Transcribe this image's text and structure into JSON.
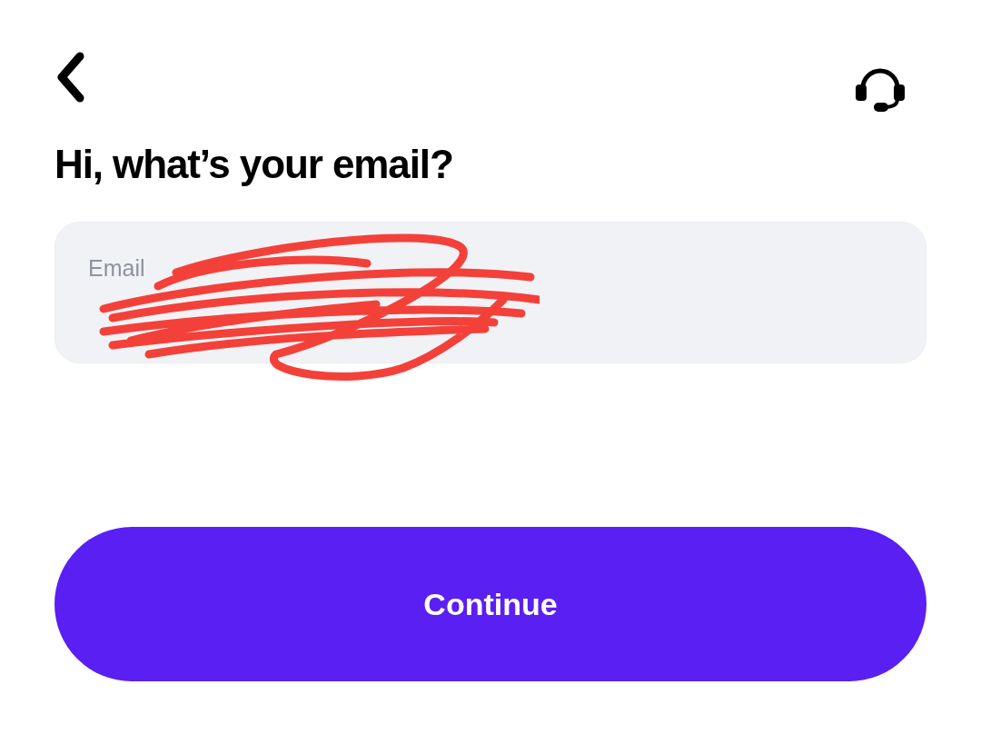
{
  "title": "Hi, what’s your email?",
  "email_field": {
    "label": "Email"
  },
  "continue_button": {
    "label": "Continue"
  }
}
